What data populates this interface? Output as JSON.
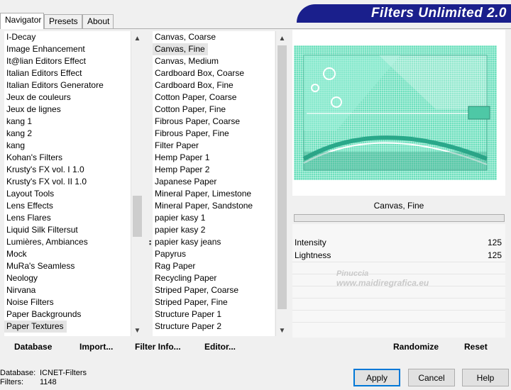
{
  "tabs": [
    {
      "label": "Navigator",
      "active": true
    },
    {
      "label": "Presets",
      "active": false
    },
    {
      "label": "About",
      "active": false
    }
  ],
  "banner": "Filters Unlimited 2.0",
  "categories": [
    "I-Decay",
    "Image Enhancement",
    "It@lian Editors Effect",
    "Italian Editors Effect",
    "Italian Editors Generatore",
    "Jeux de couleurs",
    "Jeux de lignes",
    "kang 1",
    "kang 2",
    "kang",
    "Kohan's Filters",
    "Krusty's FX vol. I 1.0",
    "Krusty's FX vol. II 1.0",
    "Layout Tools",
    "Lens Effects",
    "Lens Flares",
    "Liquid Silk Filtersut",
    "Lumières, Ambiances",
    "Mock",
    "MuRa's Seamless",
    "Neology",
    "Nirvana",
    "Noise Filters",
    "Paper Backgrounds",
    "Paper Textures"
  ],
  "filters": [
    "Canvas, Coarse",
    "Canvas, Fine",
    "Canvas, Medium",
    "Cardboard Box, Coarse",
    "Cardboard Box, Fine",
    "Cotton Paper, Coarse",
    "Cotton Paper, Fine",
    "Fibrous Paper, Coarse",
    "Fibrous Paper, Fine",
    "Filter Paper",
    "Hemp Paper 1",
    "Hemp Paper 2",
    "Japanese Paper",
    "Mineral Paper, Limestone",
    "Mineral Paper, Sandstone",
    "papier kasy 1",
    "papier kasy 2",
    "papier kasy jeans",
    "Papyrus",
    "Rag Paper",
    "Recycling Paper",
    "Striped Paper, Coarse",
    "Striped Paper, Fine",
    "Structure Paper 1",
    "Structure Paper 2"
  ],
  "selected_category_index": 24,
  "selected_filter_index": 1,
  "buttons": {
    "database": "Database",
    "import": "Import...",
    "filter_info": "Filter Info...",
    "editor": "Editor...",
    "randomize": "Randomize",
    "reset": "Reset",
    "apply": "Apply",
    "cancel": "Cancel",
    "help": "Help"
  },
  "current_filter": "Canvas, Fine",
  "params": [
    {
      "label": "Intensity",
      "value": "125"
    },
    {
      "label": "Lightness",
      "value": "125"
    }
  ],
  "watermark": {
    "line1": "Pinuccia",
    "line2": "www.maidiregrafica.eu"
  },
  "status": {
    "database_label": "Database:",
    "database_value": "ICNET-Filters",
    "filters_label": "Filters:",
    "filters_value": "1148"
  },
  "colors": {
    "banner": "#1a1f8c",
    "preview": "#6ee0be",
    "default_button_border": "#0078d7"
  }
}
